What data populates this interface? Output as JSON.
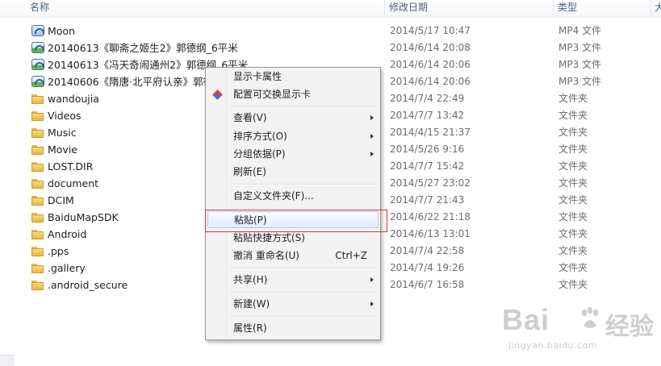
{
  "header": {
    "col_name": "名称",
    "col_date": "修改日期",
    "col_type": "类型",
    "col_size": "大"
  },
  "files": [
    {
      "name": "Moon",
      "date": "2014/5/17 10:47",
      "type": "MP4 文件",
      "icon": "media-icon"
    },
    {
      "name": "20140613《聊斋之姬生2》郭德纲_6平米",
      "date": "2014/6/14 20:08",
      "type": "MP3 文件",
      "icon": "media-icon-green"
    },
    {
      "name": "20140613《冯天奇闹通州2》郭德纲_6平米",
      "date": "2014/6/14 20:06",
      "type": "MP3 文件",
      "icon": "media-icon-green"
    },
    {
      "name": "20140606《隋唐·北平府认亲》郭德纲_6平米",
      "date": "2014/6/14 20:06",
      "type": "MP3 文件",
      "icon": "media-icon-green"
    },
    {
      "name": "wandoujia",
      "date": "2014/7/4 22:49",
      "type": "文件夹",
      "icon": "folder-icon"
    },
    {
      "name": "Videos",
      "date": "2014/7/7 13:42",
      "type": "文件夹",
      "icon": "folder-icon"
    },
    {
      "name": "Music",
      "date": "2014/4/15 21:37",
      "type": "文件夹",
      "icon": "folder-icon"
    },
    {
      "name": "Movie",
      "date": "2014/5/26 9:16",
      "type": "文件夹",
      "icon": "folder-icon"
    },
    {
      "name": "LOST.DIR",
      "date": "2014/7/7 15:42",
      "type": "文件夹",
      "icon": "folder-icon"
    },
    {
      "name": "document",
      "date": "2014/5/27 23:02",
      "type": "文件夹",
      "icon": "folder-icon"
    },
    {
      "name": "DCIM",
      "date": "2014/7/7 21:43",
      "type": "文件夹",
      "icon": "folder-icon"
    },
    {
      "name": "BaiduMapSDK",
      "date": "2014/6/22 21:18",
      "type": "文件夹",
      "icon": "folder-icon"
    },
    {
      "name": "Android",
      "date": "2014/6/13 13:01",
      "type": "文件夹",
      "icon": "folder-icon"
    },
    {
      "name": ".pps",
      "date": "2014/7/4 22:58",
      "type": "文件夹",
      "icon": "folder-icon"
    },
    {
      "name": ".gallery",
      "date": "2014/7/4 19:26",
      "type": "文件夹",
      "icon": "folder-icon"
    },
    {
      "name": ".android_secure",
      "date": "2014/6/7 16:58",
      "type": "文件夹",
      "icon": "folder-icon"
    }
  ],
  "context_menu": {
    "items": [
      {
        "label": "显示卡属性"
      },
      {
        "label": "配置可交换显示卡",
        "icon": "gpu-icon"
      },
      {
        "label": "查看(V)",
        "submenu": true
      },
      {
        "label": "排序方式(O)",
        "submenu": true
      },
      {
        "label": "分组依据(P)",
        "submenu": true
      },
      {
        "label": "刷新(E)"
      },
      {
        "label": "自定义文件夹(F)..."
      },
      {
        "label": "粘贴(P)",
        "highlighted": true
      },
      {
        "label": "粘贴快捷方式(S)"
      },
      {
        "label": "撤消 重命名(U)",
        "shortcut": "Ctrl+Z"
      },
      {
        "label": "共享(H)",
        "submenu": true
      },
      {
        "label": "新建(W)",
        "submenu": true
      },
      {
        "label": "属性(R)"
      }
    ]
  },
  "watermark": {
    "logo_text": "Bai",
    "logo_text2": "经验",
    "url": "jingyan.baidu.com"
  },
  "colors": {
    "highlight_border": "#e0323b",
    "menu_hover": "#e2eefb"
  }
}
